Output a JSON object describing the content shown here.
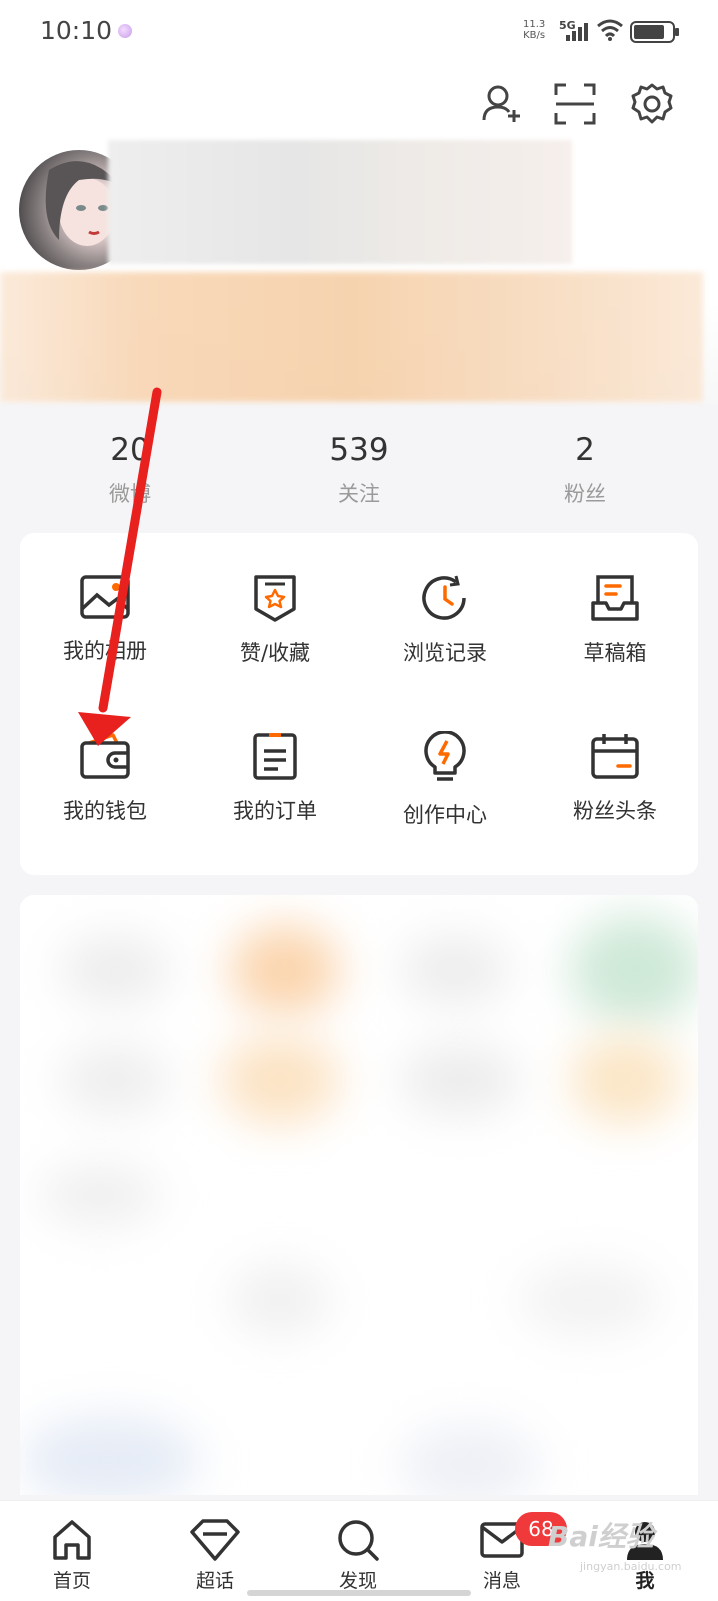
{
  "status_bar": {
    "time": "10:10",
    "net_speed_value": "11.3",
    "net_speed_unit": "KB/s",
    "network_type": "5G"
  },
  "header_actions": {
    "add_friend_icon": "add-user-icon",
    "scan_icon": "scan-icon",
    "settings_icon": "gear-icon"
  },
  "stats": [
    {
      "value": "20",
      "label": "微博"
    },
    {
      "value": "539",
      "label": "关注"
    },
    {
      "value": "2",
      "label": "粉丝"
    }
  ],
  "features": [
    {
      "label": "我的相册",
      "icon": "photo-album-icon"
    },
    {
      "label": "赞/收藏",
      "icon": "favorite-icon"
    },
    {
      "label": "浏览记录",
      "icon": "history-icon"
    },
    {
      "label": "草稿箱",
      "icon": "drafts-icon"
    },
    {
      "label": "我的钱包",
      "icon": "wallet-icon"
    },
    {
      "label": "我的订单",
      "icon": "orders-icon"
    },
    {
      "label": "创作中心",
      "icon": "creator-center-icon"
    },
    {
      "label": "粉丝头条",
      "icon": "fan-headline-icon"
    }
  ],
  "tabs": [
    {
      "label": "首页",
      "icon": "home-icon"
    },
    {
      "label": "超话",
      "icon": "diamond-icon"
    },
    {
      "label": "发现",
      "icon": "search-icon"
    },
    {
      "label": "消息",
      "icon": "mail-icon",
      "badge": "68"
    },
    {
      "label": "我",
      "icon": "profile-icon"
    }
  ],
  "watermark": {
    "text": "Bai经验",
    "sub": "jingyan.baidu.com"
  },
  "colors": {
    "accent": "#ff6a00",
    "badge": "#f0393b",
    "annotation_arrow": "#e8201e"
  }
}
